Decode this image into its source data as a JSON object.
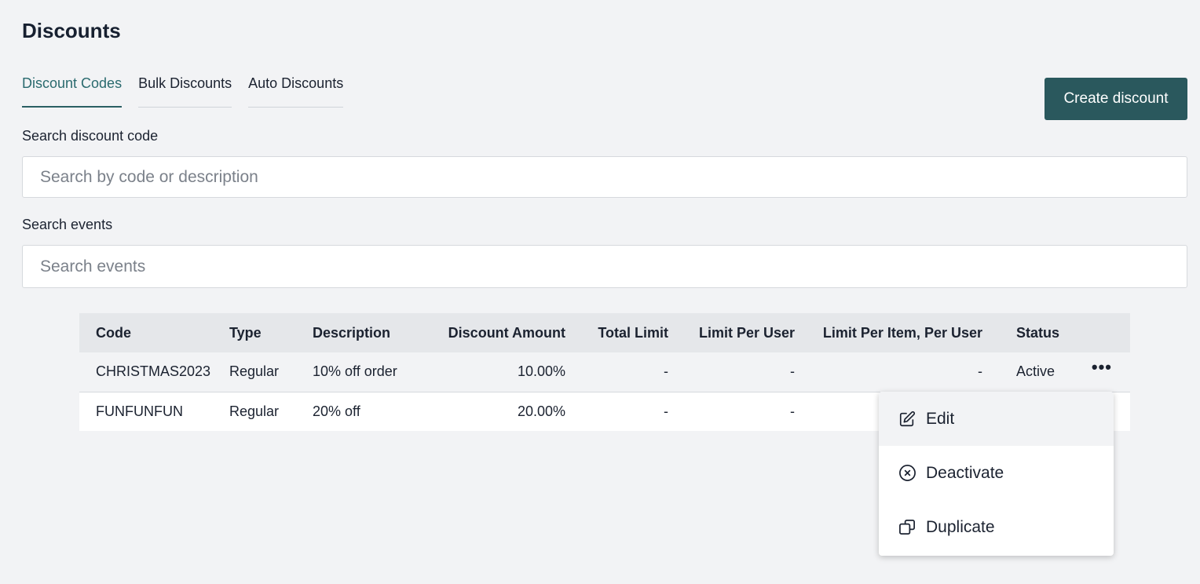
{
  "page": {
    "title": "Discounts"
  },
  "tabs": [
    {
      "label": "Discount Codes",
      "active": true
    },
    {
      "label": "Bulk Discounts",
      "active": false
    },
    {
      "label": "Auto Discounts",
      "active": false
    }
  ],
  "create_button": {
    "label": "Create discount"
  },
  "search_code": {
    "label": "Search discount code",
    "placeholder": "Search by code or description",
    "value": ""
  },
  "search_events": {
    "label": "Search events",
    "placeholder": "Search events",
    "value": ""
  },
  "table": {
    "headers": [
      "Code",
      "Type",
      "Description",
      "Discount Amount",
      "Total Limit",
      "Limit Per User",
      "Limit Per Item, Per User",
      "Status"
    ],
    "rows": [
      {
        "code": "CHRISTMAS2023",
        "type": "Regular",
        "description": "10% off order",
        "discount_amount": "10.00%",
        "total_limit": "-",
        "limit_per_user": "-",
        "limit_per_item_per_user": "-",
        "status": "Active",
        "actions_icon": "more-horizontal-icon"
      },
      {
        "code": "FUNFUNFUN",
        "type": "Regular",
        "description": "20% off",
        "discount_amount": "20.00%",
        "total_limit": "-",
        "limit_per_user": "-",
        "limit_per_item_per_user": "",
        "status": ""
      }
    ]
  },
  "actions_menu": {
    "items": [
      {
        "label": "Edit",
        "icon": "edit-icon",
        "highlighted": true
      },
      {
        "label": "Deactivate",
        "icon": "circle-x-icon",
        "highlighted": false
      },
      {
        "label": "Duplicate",
        "icon": "duplicate-icon",
        "highlighted": false
      }
    ]
  },
  "colors": {
    "accent": "#2a585d",
    "active_tab": "#2a6a6e",
    "background": "#f2f3f5"
  }
}
